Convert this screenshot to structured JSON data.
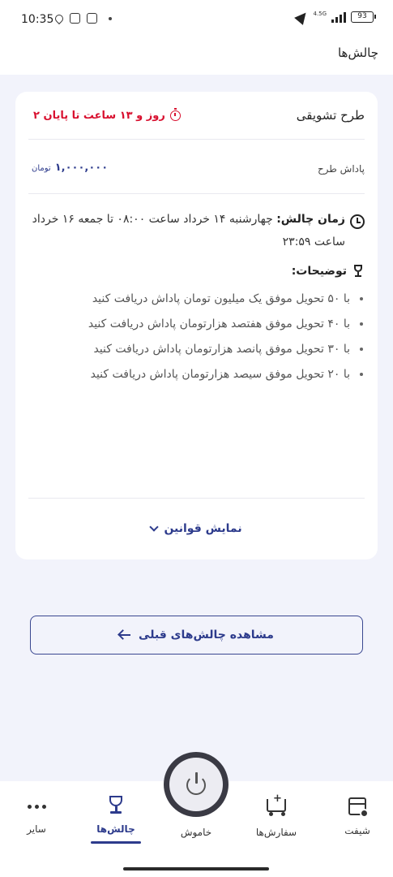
{
  "status_bar": {
    "time": "10:35",
    "network": "4.5G",
    "battery": "93",
    "icons": [
      "location-icon",
      "instagram-icon",
      "instagram-icon",
      "navigation-arrow-icon",
      "signal-icon",
      "battery-icon"
    ]
  },
  "header": {
    "title": "چالش‌ها"
  },
  "challenge": {
    "plan_title": "طرح تشویقی",
    "countdown": "۲ روز و ۱۳ ساعت  تا پایان",
    "reward_label": "پاداش طرح",
    "reward_value": "۱,۰۰۰,۰۰۰",
    "reward_currency": "تومان",
    "time_label": "زمان چالش:",
    "time_text": " چهارشنبه ۱۴ خرداد ساعت ۰۸:۰۰ تا جمعه ۱۶ خرداد ساعت ۲۳:۵۹",
    "desc_title": "توضیحات:",
    "descriptions": [
      "با ۵۰ تحویل موفق یک میلیون تومان پاداش دریافت کنید",
      "با ۴۰ تحویل موفق هفتصد هزارتومان پاداش دریافت کنید",
      "با ۳۰ تحویل موفق پانصد هزارتومان پاداش دریافت کنید",
      "با ۲۰ تحویل موفق سیصد هزارتومان پاداش دریافت کنید"
    ],
    "rules_label": "نمایش قوانین"
  },
  "previous_button": "مشاهده چالش‌های قبلی",
  "bottom_nav": {
    "shift": "شیفت",
    "orders": "سفارش‌ها",
    "power": "خاموش",
    "challenges": "چالش‌ها",
    "more": "سایر"
  },
  "colors": {
    "accent": "#2d3b8c",
    "countdown": "#d8102f",
    "background": "#f2f3fb"
  }
}
